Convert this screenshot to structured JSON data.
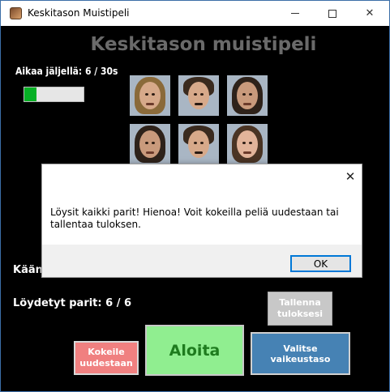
{
  "window": {
    "title": "Keskitason Muistipeli",
    "controls": {
      "minimize": "minimize-icon",
      "maximize": "maximize-icon",
      "close": "close-icon"
    }
  },
  "game": {
    "title": "Keskitason muistipeli",
    "time_label": "Aikaa jäljellä: 6 / 30s",
    "time_progress_percent": 20,
    "turns_label_visible": "Käänn",
    "found_label": "Löydetyt parit: 6 / 6"
  },
  "cards": [
    {
      "name": "card-1",
      "icon": "face-photo"
    },
    {
      "name": "card-2",
      "icon": "face-photo"
    },
    {
      "name": "card-3",
      "icon": "face-photo"
    },
    {
      "name": "card-4",
      "icon": "face-photo"
    },
    {
      "name": "card-5",
      "icon": "face-photo"
    },
    {
      "name": "card-6",
      "icon": "face-photo"
    }
  ],
  "buttons": {
    "save": "Tallenna\ntuloksesi",
    "retry": "Kokeile\nuudestaan",
    "start": "Aloita",
    "difficulty": "Valitse vaikeustaso"
  },
  "dialog": {
    "message": "Löysit kaikki parit! Hienoa! Voit kokeilla peliä uudestaan tai tallentaa tuloksen.",
    "ok_label": "OK"
  },
  "colors": {
    "background": "#000000",
    "progress": "#06b025",
    "retry": "#f08080",
    "start": "#90ee90",
    "difficulty": "#4682b4",
    "save": "#c8c8c8"
  }
}
